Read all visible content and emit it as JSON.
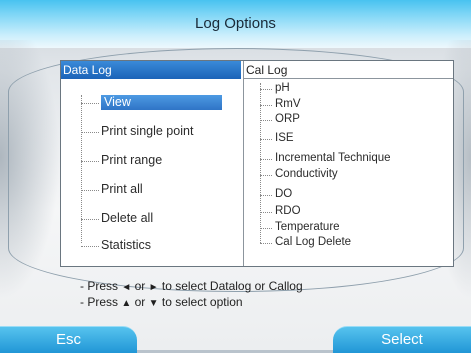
{
  "title": "Log Options",
  "tabs": {
    "datalog": "Data Log",
    "callog": "Cal Log"
  },
  "data_log_items": [
    "View",
    "Print single point",
    "Print range",
    "Print all",
    "Delete all",
    "Statistics"
  ],
  "selected_item": "View",
  "cal_log_items": [
    "pH",
    "RmV",
    "ORP",
    "ISE",
    "Incremental Technique",
    "Conductivity",
    "DO",
    "RDO",
    "Temperature",
    "Cal Log Delete"
  ],
  "help": {
    "line1_prefix": "- Press",
    "left_arrow": "◄",
    "or": "or",
    "right_arrow": "►",
    "line1_suffix": "to select Datalog or Callog",
    "line2_prefix": "- Press",
    "up_arrow": "▲",
    "down_arrow": "▼",
    "line2_suffix": "to select option"
  },
  "softkeys": {
    "left": "Esc",
    "right": "Select"
  },
  "colors": {
    "title_bar": "#48c2f0",
    "selection": "#2f74c6",
    "softkey": "#2196d6"
  }
}
